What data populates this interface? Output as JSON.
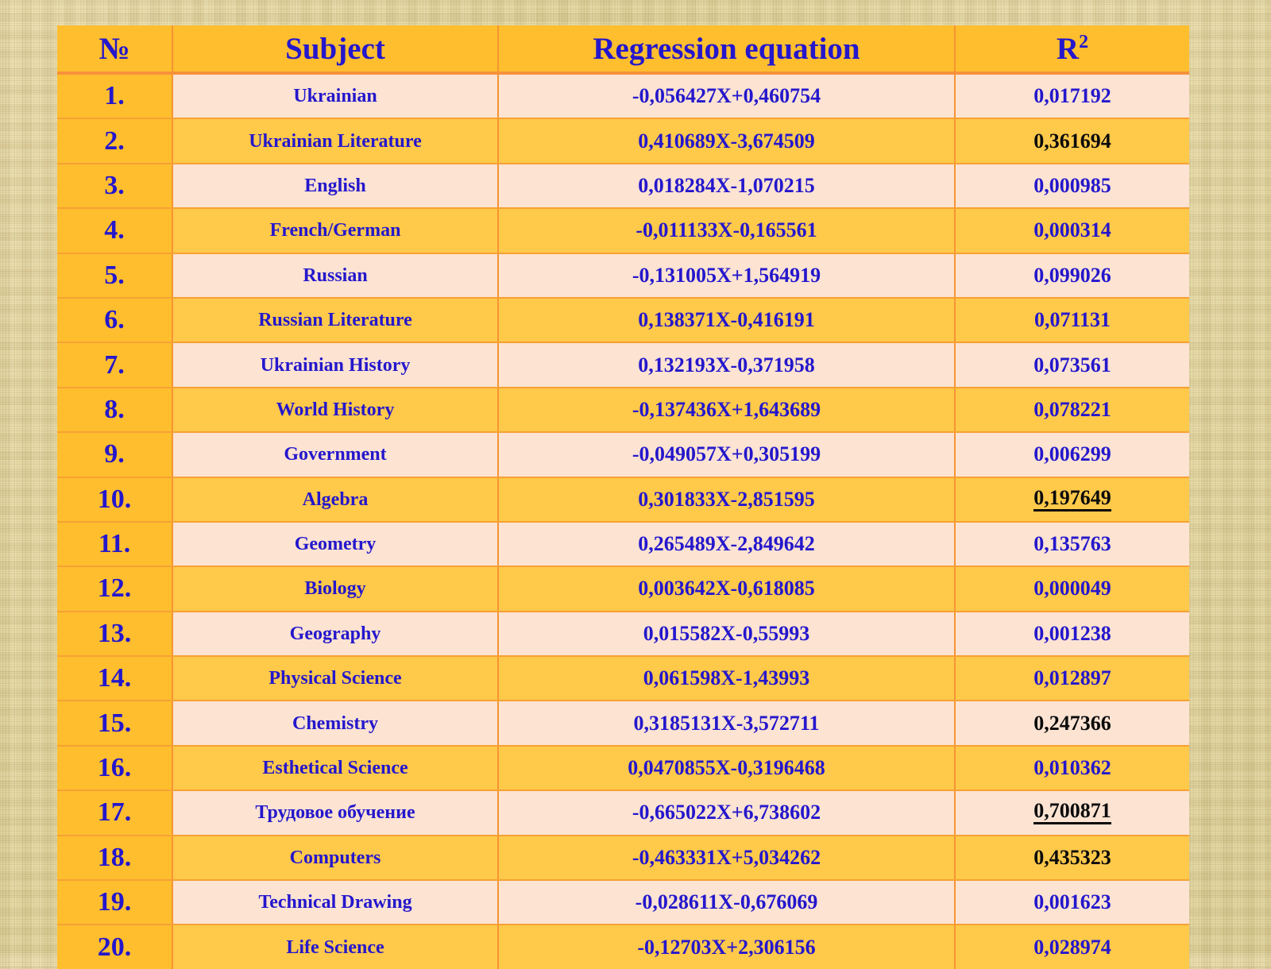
{
  "table": {
    "headers": {
      "num": "№",
      "subject": "Subject",
      "equation": "Regression equation",
      "r2_base": "R",
      "r2_sup": "2"
    },
    "colors": {
      "header_bg": "#FFBE2E",
      "row_light": "#FCE3D2",
      "row_dark": "#FFC94A",
      "num_col_bg": "#FFBE2E",
      "text_blue": "#2417CC",
      "text_black": "#0B0B0B",
      "border": "#F79432",
      "page_bg": "#E2D49A"
    },
    "rows": [
      {
        "num": "1.",
        "subject": "Ukrainian",
        "equation": "-0,056427X+0,460754",
        "r2": "0,017192",
        "r2_color": "blue",
        "r2_underline": false
      },
      {
        "num": "2.",
        "subject": "Ukrainian Literature",
        "equation": "0,410689X-3,674509",
        "r2": "0,361694",
        "r2_color": "black",
        "r2_underline": false
      },
      {
        "num": "3.",
        "subject": "English",
        "equation": "0,018284X-1,070215",
        "r2": "0,000985",
        "r2_color": "blue",
        "r2_underline": false
      },
      {
        "num": "4.",
        "subject": "French/German",
        "equation": "-0,011133X-0,165561",
        "r2": "0,000314",
        "r2_color": "blue",
        "r2_underline": false
      },
      {
        "num": "5.",
        "subject": "Russian",
        "equation": "-0,131005X+1,564919",
        "r2": "0,099026",
        "r2_color": "blue",
        "r2_underline": false
      },
      {
        "num": "6.",
        "subject": "Russian Literature",
        "equation": "0,138371X-0,416191",
        "r2": "0,071131",
        "r2_color": "blue",
        "r2_underline": false
      },
      {
        "num": "7.",
        "subject": "Ukrainian History",
        "equation": "0,132193X-0,371958",
        "r2": "0,073561",
        "r2_color": "blue",
        "r2_underline": false
      },
      {
        "num": "8.",
        "subject": "World History",
        "equation": "-0,137436X+1,643689",
        "r2": "0,078221",
        "r2_color": "blue",
        "r2_underline": false
      },
      {
        "num": "9.",
        "subject": "Government",
        "equation": "-0,049057X+0,305199",
        "r2": "0,006299",
        "r2_color": "blue",
        "r2_underline": false
      },
      {
        "num": "10.",
        "subject": "Algebra",
        "equation": "0,301833X-2,851595",
        "r2": "0,197649",
        "r2_color": "black",
        "r2_underline": true
      },
      {
        "num": "11.",
        "subject": "Geometry",
        "equation": "0,265489X-2,849642",
        "r2": "0,135763",
        "r2_color": "blue",
        "r2_underline": false
      },
      {
        "num": "12.",
        "subject": "Biology",
        "equation": "0,003642X-0,618085",
        "r2": "0,000049",
        "r2_color": "blue",
        "r2_underline": false
      },
      {
        "num": "13.",
        "subject": "Geography",
        "equation": "0,015582X-0,55993",
        "r2": "0,001238",
        "r2_color": "blue",
        "r2_underline": false
      },
      {
        "num": "14.",
        "subject": "Physical Science",
        "equation": "0,061598X-1,43993",
        "r2": "0,012897",
        "r2_color": "blue",
        "r2_underline": false
      },
      {
        "num": "15.",
        "subject": "Chemistry",
        "equation": "0,3185131X-3,572711",
        "r2": "0,247366",
        "r2_color": "black",
        "r2_underline": false
      },
      {
        "num": "16.",
        "subject": "Esthetical Science",
        "equation": "0,0470855X-0,3196468",
        "r2": "0,010362",
        "r2_color": "blue",
        "r2_underline": false
      },
      {
        "num": "17.",
        "subject": "Трудовое обучение",
        "equation": "-0,665022X+6,738602",
        "r2": "0,700871",
        "r2_color": "black",
        "r2_underline": true
      },
      {
        "num": "18.",
        "subject": "Computers",
        "equation": "-0,463331X+5,034262",
        "r2": "0,435323",
        "r2_color": "black",
        "r2_underline": false
      },
      {
        "num": "19.",
        "subject": "Technical Drawing",
        "equation": "-0,028611X-0,676069",
        "r2": "0,001623",
        "r2_color": "blue",
        "r2_underline": false
      },
      {
        "num": "20.",
        "subject": "Life Science",
        "equation": "-0,12703X+2,306156",
        "r2": "0,028974",
        "r2_color": "blue",
        "r2_underline": false
      }
    ]
  }
}
